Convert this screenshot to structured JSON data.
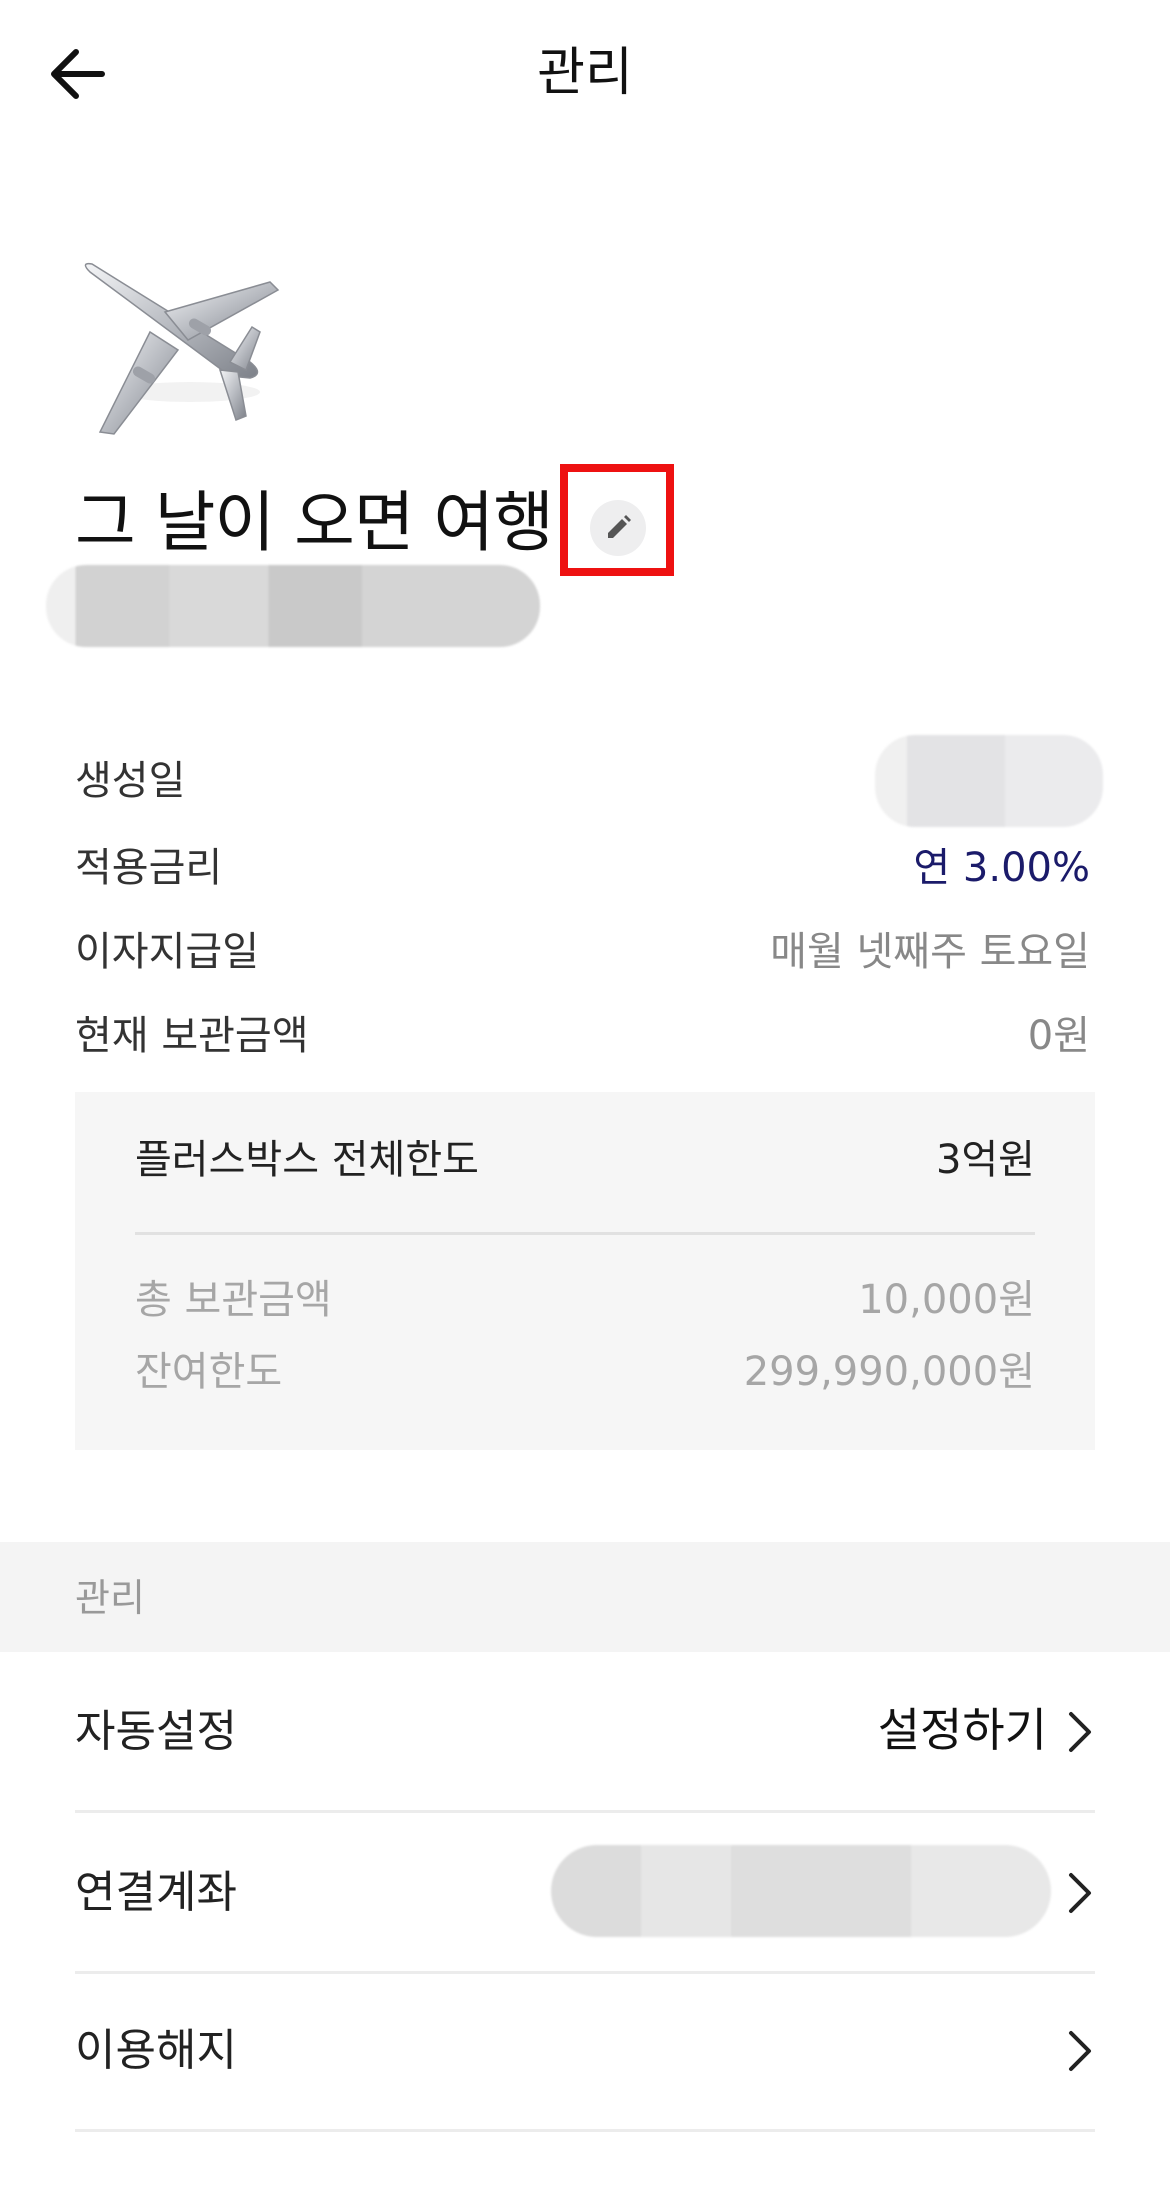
{
  "header": {
    "title": "관리",
    "back_icon": "arrow-left-icon"
  },
  "savings_box": {
    "icon": "airplane-icon",
    "title": "그 날이 오면 여행",
    "edit_icon": "pencil-icon"
  },
  "info": {
    "created_label": "생성일",
    "rate_label": "적용금리",
    "rate_value": "연 3.00%",
    "interest_day_label": "이자지급일",
    "interest_day_value": "매월 넷째주 토요일",
    "current_amount_label": "현재 보관금액",
    "current_amount_value": "0원"
  },
  "limit_panel": {
    "total_limit_label": "플러스박스 전체한도",
    "total_limit_value": "3억원",
    "total_stored_label": "총 보관금액",
    "total_stored_value": "10,000원",
    "remaining_label": "잔여한도",
    "remaining_value": "299,990,000원"
  },
  "manage_section": {
    "header": "관리",
    "items": [
      {
        "label": "자동설정",
        "action": "설정하기"
      },
      {
        "label": "연결계좌"
      },
      {
        "label": "이용해지"
      }
    ],
    "chevron_icon": "chevron-right-icon"
  },
  "colors": {
    "accent_rate": "#1b1b6a",
    "highlight": "#ee1111",
    "panel_bg": "#f6f6f6"
  }
}
